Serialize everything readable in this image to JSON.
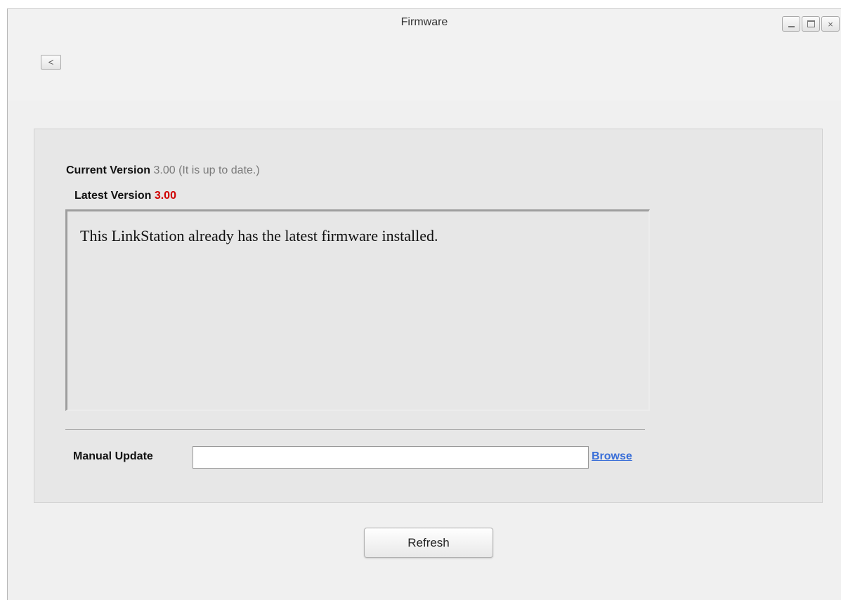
{
  "window": {
    "title": "Firmware",
    "controls": {
      "minimize": "minimize-icon",
      "maximize": "maximize-icon",
      "close": "×"
    }
  },
  "nav": {
    "back_label": "<"
  },
  "firmware": {
    "current_version_label": "Current Version",
    "current_version_value": "3.00 (It is up to date.)",
    "latest_version_label": "Latest Version",
    "latest_version_value": "3.00",
    "message": "This LinkStation already has the latest firmware installed."
  },
  "manual_update": {
    "label": "Manual Update",
    "value": "",
    "browse_label": "Browse"
  },
  "actions": {
    "refresh_label": "Refresh"
  },
  "colors": {
    "latest_version": "#d00000",
    "link": "#3a6fd8",
    "panel_bg": "#e7e7e7"
  }
}
